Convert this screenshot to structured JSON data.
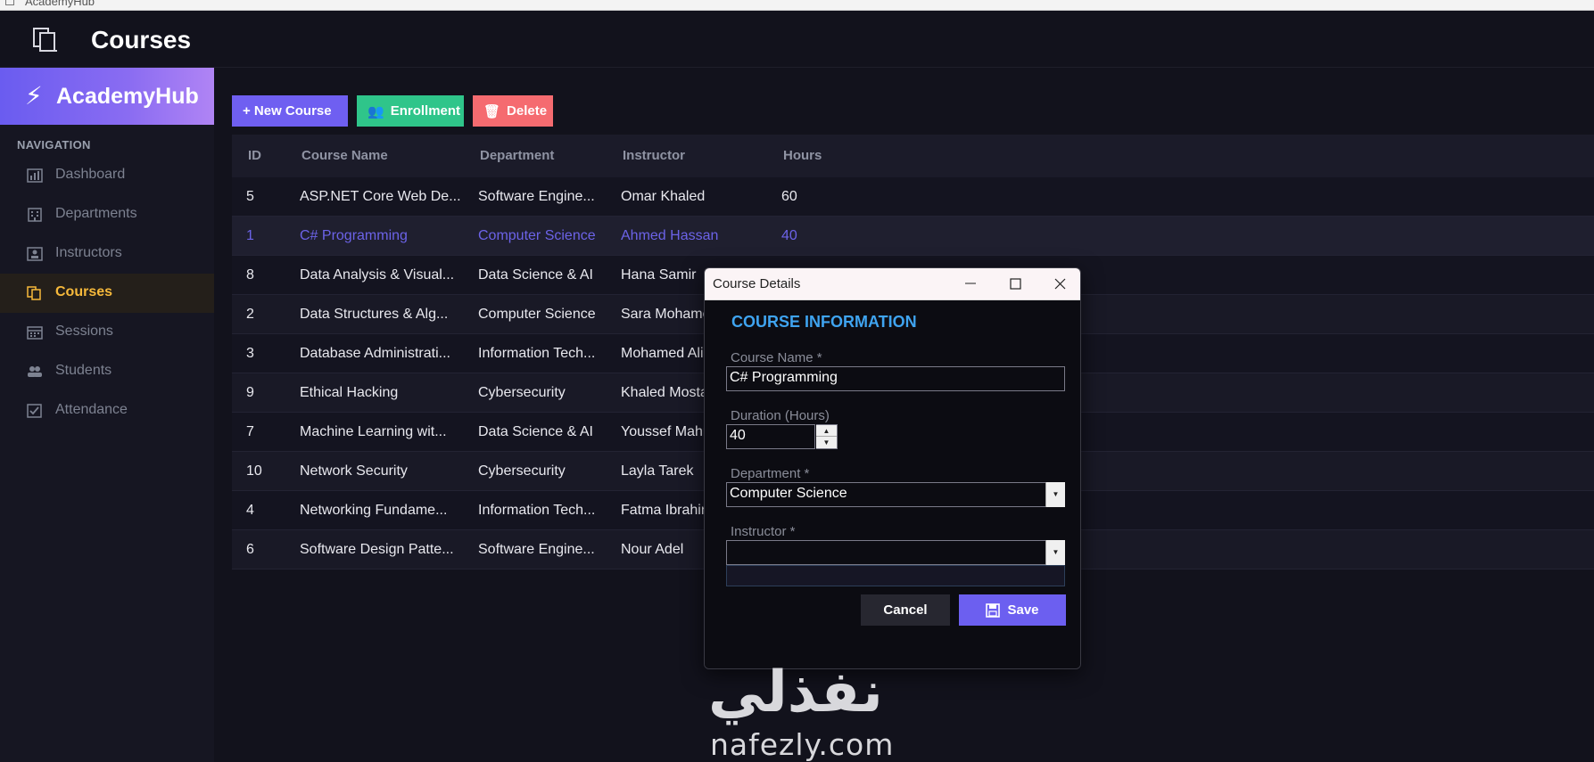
{
  "window": {
    "title": "AcademyHub"
  },
  "topbar": {
    "page_title": "Courses",
    "icon": "courses-icon"
  },
  "sidebar": {
    "brand": "AcademyHub",
    "brand_icon": "bolt-icon",
    "heading": "NAVIGATION",
    "items": [
      {
        "label": "Dashboard",
        "icon": "bar-chart-icon",
        "active": false
      },
      {
        "label": "Departments",
        "icon": "building-icon",
        "active": false
      },
      {
        "label": "Instructors",
        "icon": "teacher-icon",
        "active": false
      },
      {
        "label": "Courses",
        "icon": "courses-icon",
        "active": true
      },
      {
        "label": "Sessions",
        "icon": "calendar-icon",
        "active": false
      },
      {
        "label": "Students",
        "icon": "users-icon",
        "active": false
      },
      {
        "label": "Attendance",
        "icon": "checkbox-icon",
        "active": false
      }
    ]
  },
  "toolbar": {
    "new_label": "+ New Course",
    "enroll_label": "Enrollment",
    "delete_label": "Delete"
  },
  "table": {
    "columns": [
      "ID",
      "Course Name",
      "Department",
      "Instructor",
      "Hours"
    ],
    "rows": [
      {
        "id": "5",
        "name": "ASP.NET Core Web De...",
        "dept": "Software Engine...",
        "instructor": "Omar Khaled",
        "hours": "60",
        "selected": false
      },
      {
        "id": "1",
        "name": "C# Programming",
        "dept": "Computer Science",
        "instructor": "Ahmed Hassan",
        "hours": "40",
        "selected": true
      },
      {
        "id": "8",
        "name": "Data Analysis & Visual...",
        "dept": "Data Science & AI",
        "instructor": "Hana Samir",
        "hours": "",
        "selected": false
      },
      {
        "id": "2",
        "name": "Data Structures & Alg...",
        "dept": "Computer Science",
        "instructor": "Sara Mohame",
        "hours": "",
        "selected": false
      },
      {
        "id": "3",
        "name": "Database Administrati...",
        "dept": "Information Tech...",
        "instructor": "Mohamed Ali",
        "hours": "",
        "selected": false
      },
      {
        "id": "9",
        "name": "Ethical Hacking",
        "dept": "Cybersecurity",
        "instructor": "Khaled Mosta",
        "hours": "",
        "selected": false
      },
      {
        "id": "7",
        "name": "Machine Learning wit...",
        "dept": "Data Science & AI",
        "instructor": "Youssef Mahr",
        "hours": "",
        "selected": false
      },
      {
        "id": "10",
        "name": "Network Security",
        "dept": "Cybersecurity",
        "instructor": "Layla Tarek",
        "hours": "",
        "selected": false
      },
      {
        "id": "4",
        "name": "Networking Fundame...",
        "dept": "Information Tech...",
        "instructor": "Fatma Ibrahin",
        "hours": "",
        "selected": false
      },
      {
        "id": "6",
        "name": "Software Design Patte...",
        "dept": "Software Engine...",
        "instructor": "Nour Adel",
        "hours": "",
        "selected": false
      }
    ]
  },
  "dialog": {
    "title": "Course Details",
    "section_title": "COURSE INFORMATION",
    "course_name_label": "Course Name *",
    "course_name_value": "C# Programming",
    "duration_label": "Duration (Hours)",
    "duration_value": "40",
    "department_label": "Department *",
    "department_value": "Computer Science",
    "instructor_label": "Instructor *",
    "instructor_value": "",
    "cancel_label": "Cancel",
    "save_label": "Save"
  },
  "watermark": {
    "arabic": "نفذلي",
    "latin": "nafezly.com"
  },
  "colors": {
    "accent": "#6f5ff1",
    "enroll": "#2fc58a",
    "delete": "#f56b70",
    "active_nav": "#f6b93b",
    "section_title": "#3fa4f0"
  }
}
